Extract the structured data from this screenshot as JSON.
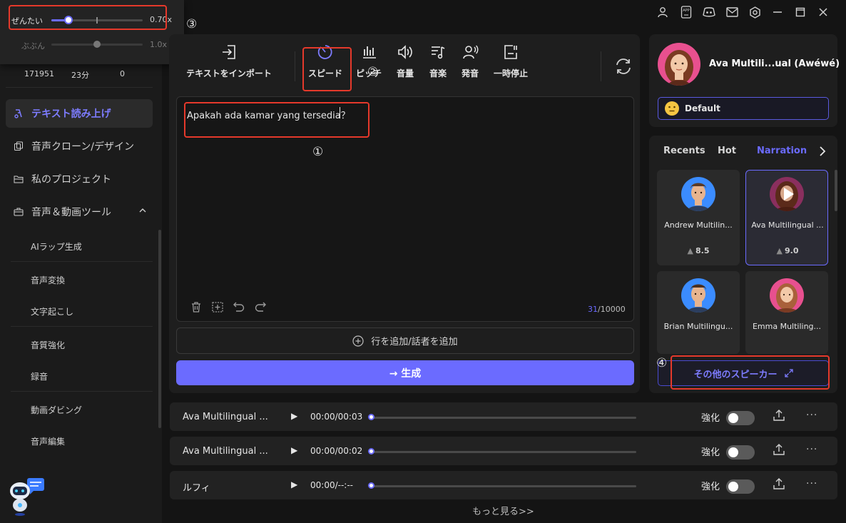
{
  "popover": {
    "slider1_label": "ぜんたい",
    "slider1_value": "0.70x",
    "slider1_level": 0.19,
    "slider2_label": "ぶぶん",
    "slider2_value": "1.0x",
    "slider2_level": 0.5
  },
  "stats": {
    "a": "171951",
    "b": "23分",
    "c": "0"
  },
  "sidebar": {
    "items": [
      {
        "label": "テキスト読み上げ"
      },
      {
        "label": "音声クローン/デザイン"
      },
      {
        "label": "私のプロジェクト"
      },
      {
        "label": "音声＆動画ツール"
      }
    ],
    "subitems": [
      {
        "label": "AIラップ生成"
      },
      {
        "label": "音声変換"
      },
      {
        "label": "文字起こし"
      },
      {
        "label": "音質強化"
      },
      {
        "label": "録音"
      },
      {
        "label": "動画ダビング"
      },
      {
        "label": "音声編集"
      }
    ]
  },
  "toolbar": {
    "import": "テキストをインポート",
    "speed": "スピード",
    "pitch": "ピッチ",
    "volume": "音量",
    "music": "音楽",
    "pronounce": "発音",
    "pause": "一時停止"
  },
  "editor": {
    "text": "Apakah ada kamar yang tersedia？",
    "count_used": "31",
    "count_total": "/10000",
    "add_line": "行を追加/話者を追加",
    "generate": "→ 生成"
  },
  "annotations": {
    "n1": "①",
    "n2": "②",
    "n3": "③",
    "n4": "④"
  },
  "speaker": {
    "name": "Ava Multili...ual (Awéwé)",
    "style": "Default"
  },
  "tabs": [
    "Recents",
    "Hot",
    "Narration"
  ],
  "cards": [
    {
      "name": "Andrew Multilin...",
      "rating": "8.5"
    },
    {
      "name": "Ava Multilingual ...",
      "rating": "9.0"
    },
    {
      "name": "Brian Multilingu..."
    },
    {
      "name": "Emma Multiling..."
    }
  ],
  "more_speakers": "その他のスピーカー",
  "history": [
    {
      "name": "Ava Multilingual ...",
      "time": "00:00/00:03",
      "enhance": "強化"
    },
    {
      "name": "Ava Multilingual ...",
      "time": "00:00/00:02",
      "enhance": "強化"
    },
    {
      "name": "ルフィ",
      "time": "00:00/--:--",
      "enhance": "強化"
    }
  ],
  "see_more": "もっと見る>>",
  "top_icons": [
    "user-icon",
    "app-icon",
    "discord-icon",
    "mail-icon",
    "settings-icon",
    "minimize-icon",
    "maximize-icon",
    "close-icon"
  ],
  "colors": {
    "accent": "#6b6bff",
    "highlight": "#e5392b"
  }
}
